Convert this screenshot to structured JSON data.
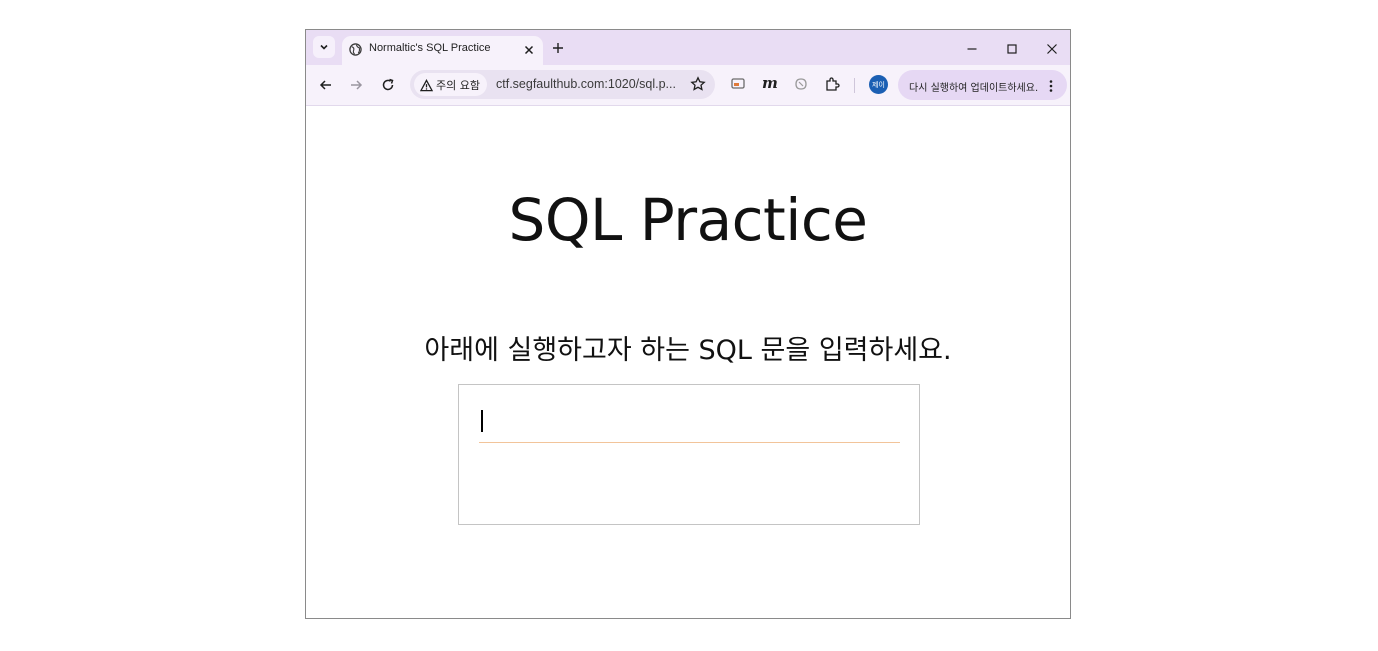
{
  "browser": {
    "tab": {
      "title": "Normaltic's SQL Practice"
    },
    "new_tab_label": "+",
    "omnibox": {
      "security_label": "주의 요함",
      "url": "ctf.segfaulthub.com:1020/sql.p..."
    },
    "profile_label": "제이",
    "update_label": "다시 실행하여 업데이트하세요."
  },
  "page": {
    "title": "SQL Practice",
    "instruction": "아래에 실행하고자 하는 SQL 문을 입력하세요.",
    "query_input": {
      "value": "",
      "placeholder": ""
    }
  },
  "colors": {
    "tabstrip_bg": "#e9ddf4",
    "toolbar_bg": "#f7f2fb",
    "omnibox_bg": "#e9e2f1",
    "profile_avatar": "#1b5fb3",
    "input_underline": "#f2c49a"
  }
}
